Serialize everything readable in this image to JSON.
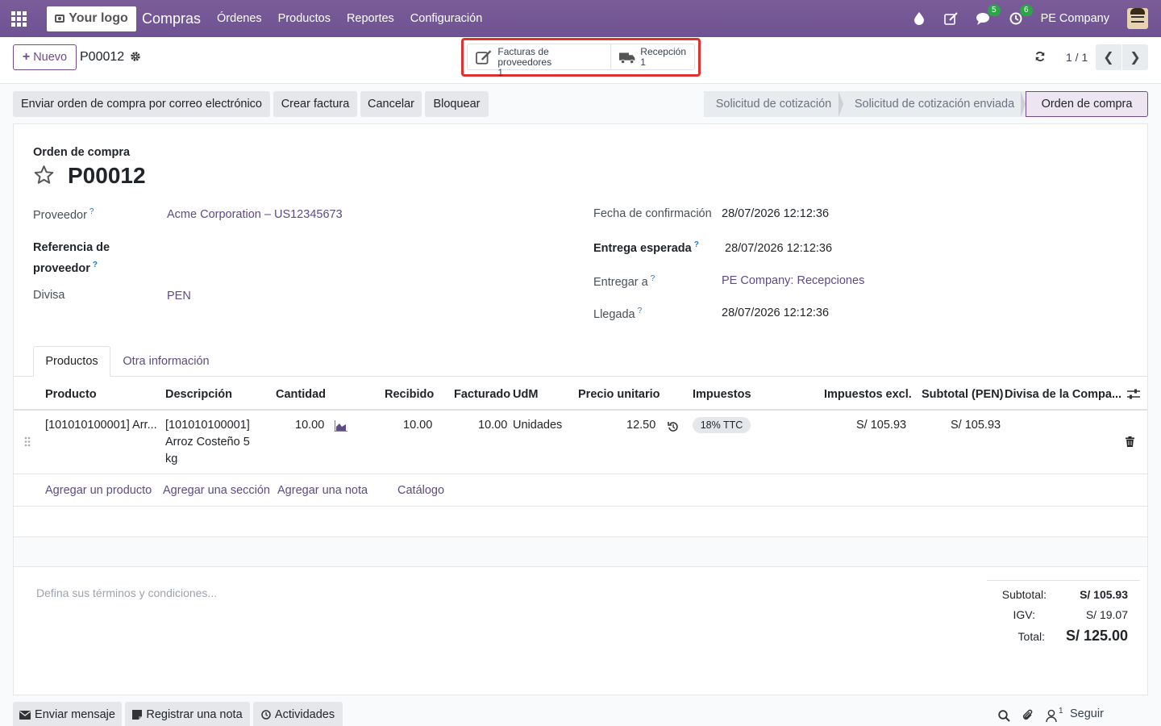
{
  "navbar": {
    "logo": "Your logo",
    "app": "Compras",
    "menu": [
      "Órdenes",
      "Productos",
      "Reportes",
      "Configuración"
    ],
    "messages_badge": "5",
    "activities_badge": "6",
    "company": "PE Company"
  },
  "control": {
    "new_label": "Nuevo",
    "record_name": "P00012",
    "smart_buttons": [
      {
        "label": "Facturas de proveedores",
        "count": "1",
        "icon": "edit-document-icon"
      },
      {
        "label": "Recepción",
        "count": "1",
        "icon": "truck-icon"
      }
    ],
    "pager": "1 / 1"
  },
  "actions": [
    "Enviar orden de compra por correo electrónico",
    "Crear factura",
    "Cancelar",
    "Bloquear"
  ],
  "status": {
    "stages": [
      "Solicitud de cotización",
      "Solicitud de cotización enviada",
      "Orden de compra"
    ],
    "active": "Orden de compra"
  },
  "form": {
    "title_label": "Orden de compra",
    "name": "P00012",
    "left": [
      {
        "label": "Proveedor",
        "value": "Acme Corporation – US12345673"
      },
      {
        "label": "Referencia de proveedor",
        "value": ""
      },
      {
        "label": "Divisa",
        "value": "PEN"
      }
    ],
    "right": [
      {
        "label": "Fecha de confirmación",
        "value": "28/07/2026 12:12:36"
      },
      {
        "label": "Entrega esperada",
        "value": "28/07/2026 12:12:36"
      },
      {
        "label": "Entregar a",
        "value": "PE Company: Recepciones"
      },
      {
        "label": "Llegada",
        "value": "28/07/2026 12:12:36"
      }
    ]
  },
  "tabs": [
    "Productos",
    "Otra información"
  ],
  "table": {
    "headers": [
      "Producto",
      "Descripción",
      "Cantidad",
      "Recibido",
      "Facturado",
      "UdM",
      "Precio unitario",
      "Impuestos",
      "Impuestos excl.",
      "Subtotal (PEN)",
      "Divisa de la Compa..."
    ],
    "rows": [
      {
        "producto": "[101010100001] Arr...",
        "descripcion_1": "[101010100001]",
        "descripcion_2": "Arroz Costeño 5",
        "descripcion_3": "kg",
        "cantidad": "10.00",
        "recibido": "10.00",
        "facturado": "10.00",
        "udm": "Unidades",
        "precio": "12.50",
        "impuesto": "18% TTC",
        "impuestos_excl": "S/ 105.93",
        "subtotal": "S/ 105.93"
      }
    ],
    "add_links": [
      "Agregar un producto",
      "Agregar una sección",
      "Agregar una nota",
      "Catálogo"
    ]
  },
  "terms_placeholder": "Defina sus términos y condiciones...",
  "totals": {
    "subtotal_label": "Subtotal:",
    "subtotal": "S/ 105.93",
    "igv_label": "IGV:",
    "igv": "S/ 19.07",
    "total_label": "Total:",
    "total": "S/ 125.00"
  },
  "chatter": {
    "buttons": [
      "Enviar mensaje",
      "Registrar una nota",
      "Actividades"
    ],
    "followers_count": "1",
    "follow": "Seguir"
  }
}
